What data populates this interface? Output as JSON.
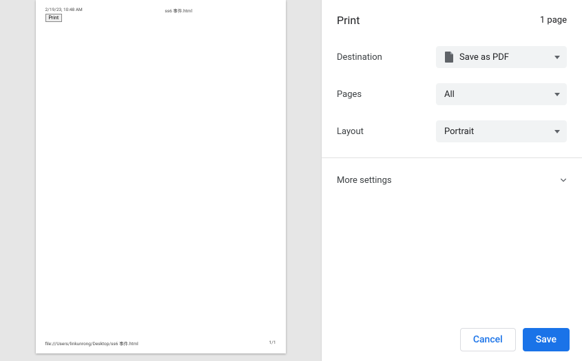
{
  "preview": {
    "timestamp": "2/19/23, 10:48 AM",
    "doc_title": "ss6 事件.html",
    "print_btn_label": "Print",
    "footer_path": "file:///Users/linkunrong/Desktop/ss6 事件.html",
    "page_indicator": "1/1"
  },
  "header": {
    "title": "Print",
    "page_count": "1 page"
  },
  "options": {
    "destination": {
      "label": "Destination",
      "value": "Save as PDF"
    },
    "pages": {
      "label": "Pages",
      "value": "All"
    },
    "layout": {
      "label": "Layout",
      "value": "Portrait"
    }
  },
  "more_settings": {
    "label": "More settings"
  },
  "actions": {
    "cancel": "Cancel",
    "save": "Save"
  }
}
